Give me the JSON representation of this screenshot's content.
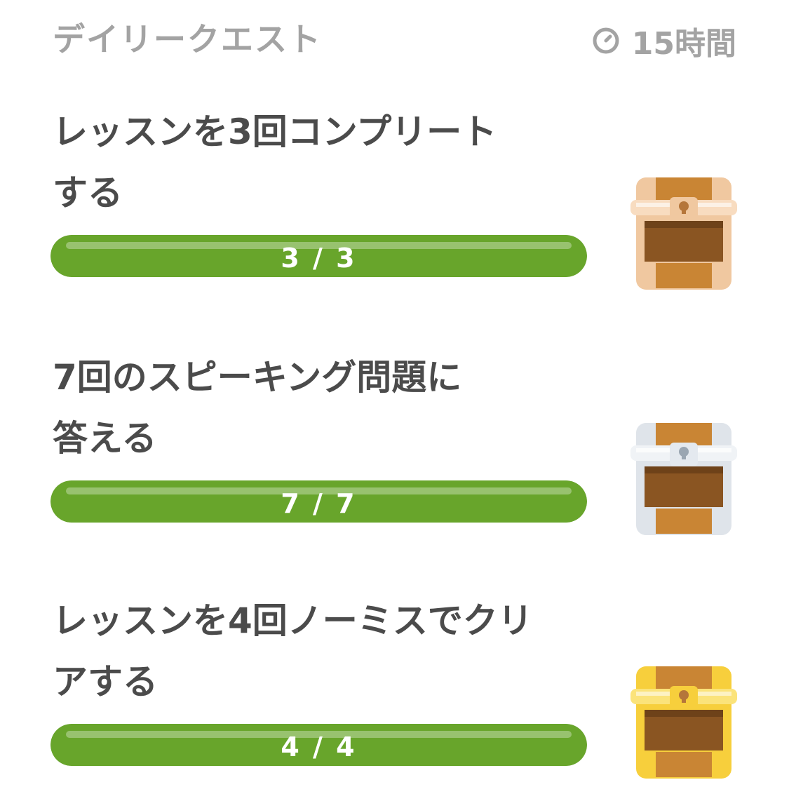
{
  "header": {
    "title": "デイリークエスト",
    "timer_icon": "timer-icon",
    "time_left": "15時間"
  },
  "quests": [
    {
      "title_line1": "レッスンを3回コンプリート",
      "title_line2": "する",
      "progress_label": "3 / 3",
      "current": 3,
      "total": 3,
      "reward_icon": "bronze-chest-icon"
    },
    {
      "title_line1": "7回のスピーキング問題に",
      "title_line2": "答える",
      "progress_label": "7 / 7",
      "current": 7,
      "total": 7,
      "reward_icon": "silver-chest-icon"
    },
    {
      "title_line1": "レッスンを4回ノーミスでクリ",
      "title_line2": "アする",
      "progress_label": "4 / 4",
      "current": 4,
      "total": 4,
      "reward_icon": "gold-chest-icon"
    }
  ],
  "colors": {
    "progress_fill": "#68a52b",
    "header_text": "#a3a3a3",
    "title_text": "#4b4b4b",
    "bronze_frame": "#f0c8a0",
    "silver_frame": "#e4e9ef",
    "gold_frame": "#fbe37a",
    "chest_wood": "#c98534",
    "chest_inner": "#8a5522"
  }
}
